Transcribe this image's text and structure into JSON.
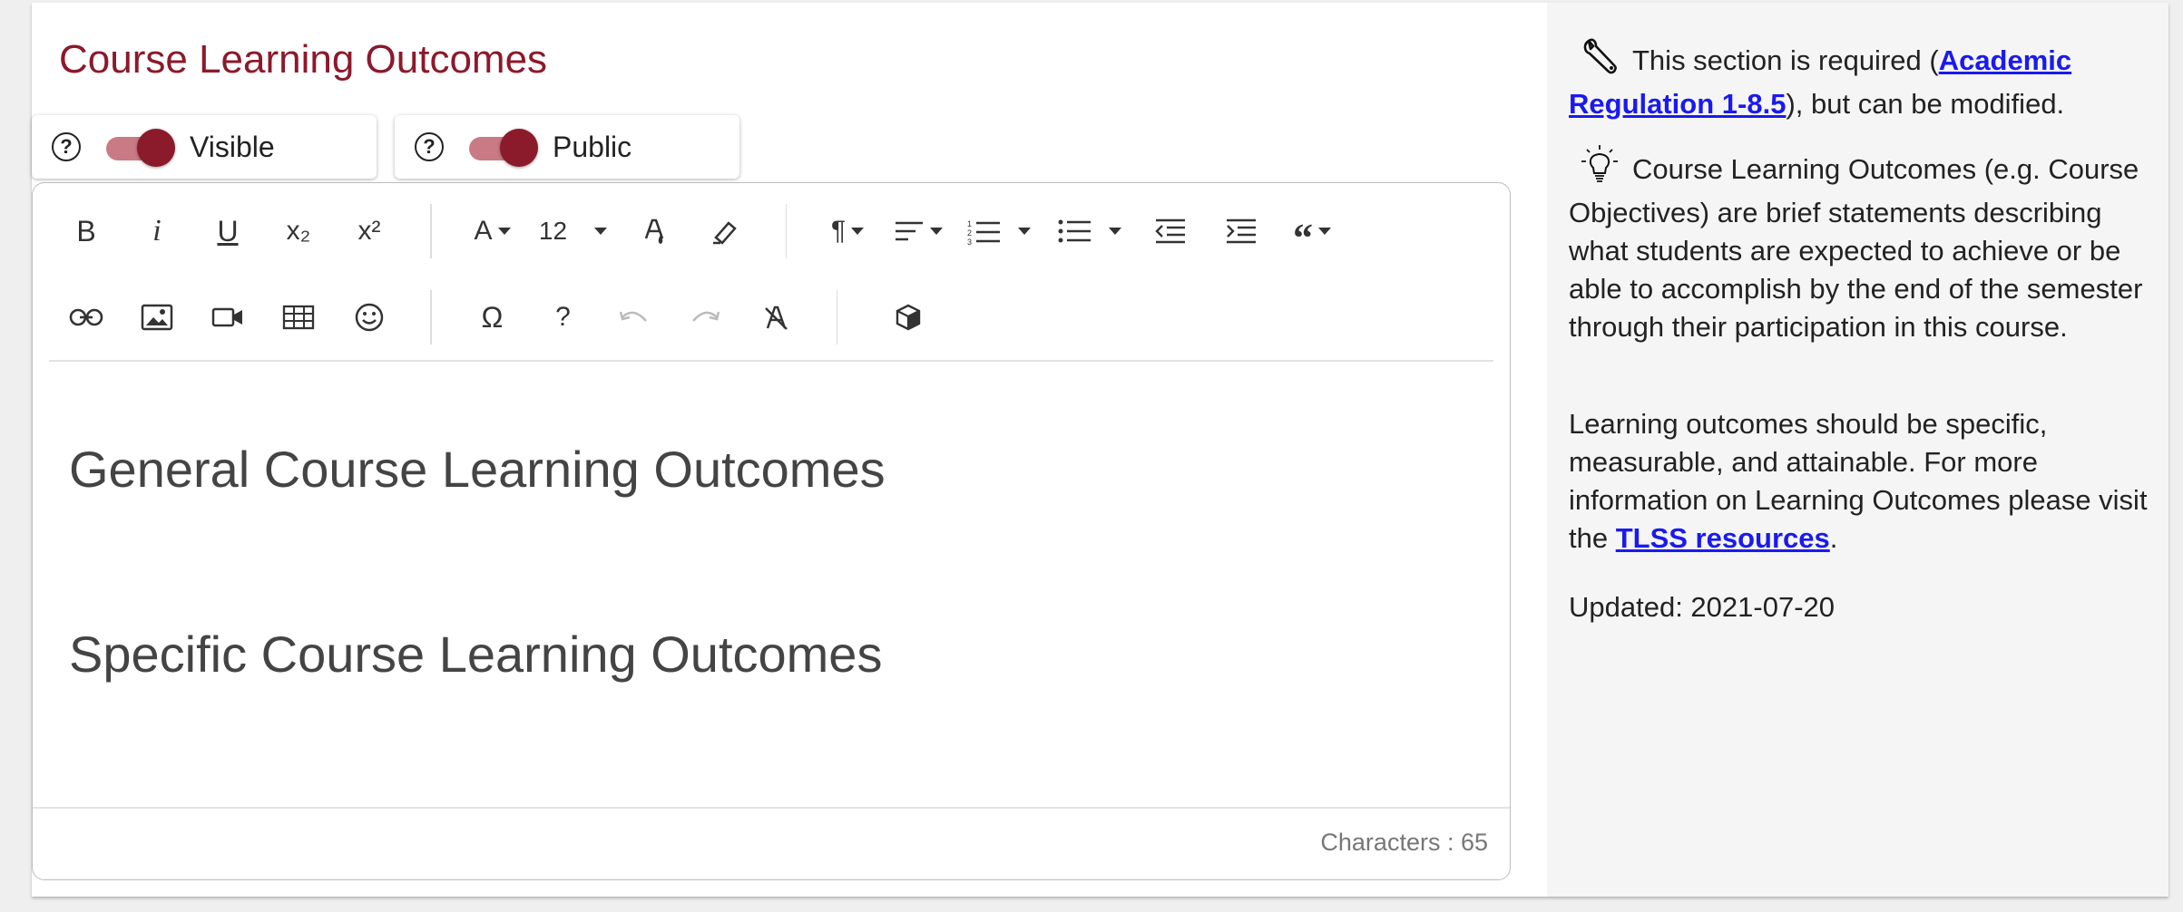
{
  "page": {
    "title": "Course Learning Outcomes"
  },
  "toggles": {
    "visible": {
      "label": "Visible",
      "state": "on"
    },
    "public": {
      "label": "Public",
      "state": "on"
    }
  },
  "toolbar": {
    "bold": "B",
    "italic": "i",
    "underline": "U",
    "subscript": "x₂",
    "superscript": "x²",
    "font_family": "A",
    "font_size": "12",
    "special_chars": "Ω",
    "help": "?",
    "icons": [
      "bold",
      "italic",
      "underline",
      "subscript",
      "superscript",
      "font-family-icon",
      "font-size",
      "text-color-icon",
      "highlight-icon",
      "paragraph-format-icon",
      "align-icon",
      "ordered-list-icon",
      "unordered-list-icon",
      "outdent-icon",
      "indent-icon",
      "quote-icon",
      "link-icon",
      "image-icon",
      "video-icon",
      "table-icon",
      "emoticon-icon",
      "special-characters-icon",
      "help-icon",
      "undo-icon",
      "redo-icon",
      "clear-formatting-icon",
      "embed-icon"
    ]
  },
  "editor": {
    "headings": [
      "General Course Learning Outcomes",
      "Specific Course Learning Outcomes"
    ],
    "char_count": "Characters : 65"
  },
  "sidebar": {
    "required_prefix": "This section is required (",
    "required_link": "Academic Regulation 1-8.5",
    "required_suffix": "), but can be modified.",
    "description": "Course Learning Outcomes (e.g. Course Objectives) are brief statements describing what students are expected to achieve or be able to accomplish by the end of the semester through their participation in this course.",
    "guidance_prefix": "Learning outcomes should be specific, measurable, and attainable. For more information on Learning Outcomes please visit the ",
    "guidance_link": "TLSS resources",
    "guidance_suffix": ".",
    "updated": "Updated: 2021-07-20"
  },
  "colors": {
    "accent": "#8b1a2b",
    "toggle_track": "#c97a84",
    "link": "#1a1aee"
  }
}
